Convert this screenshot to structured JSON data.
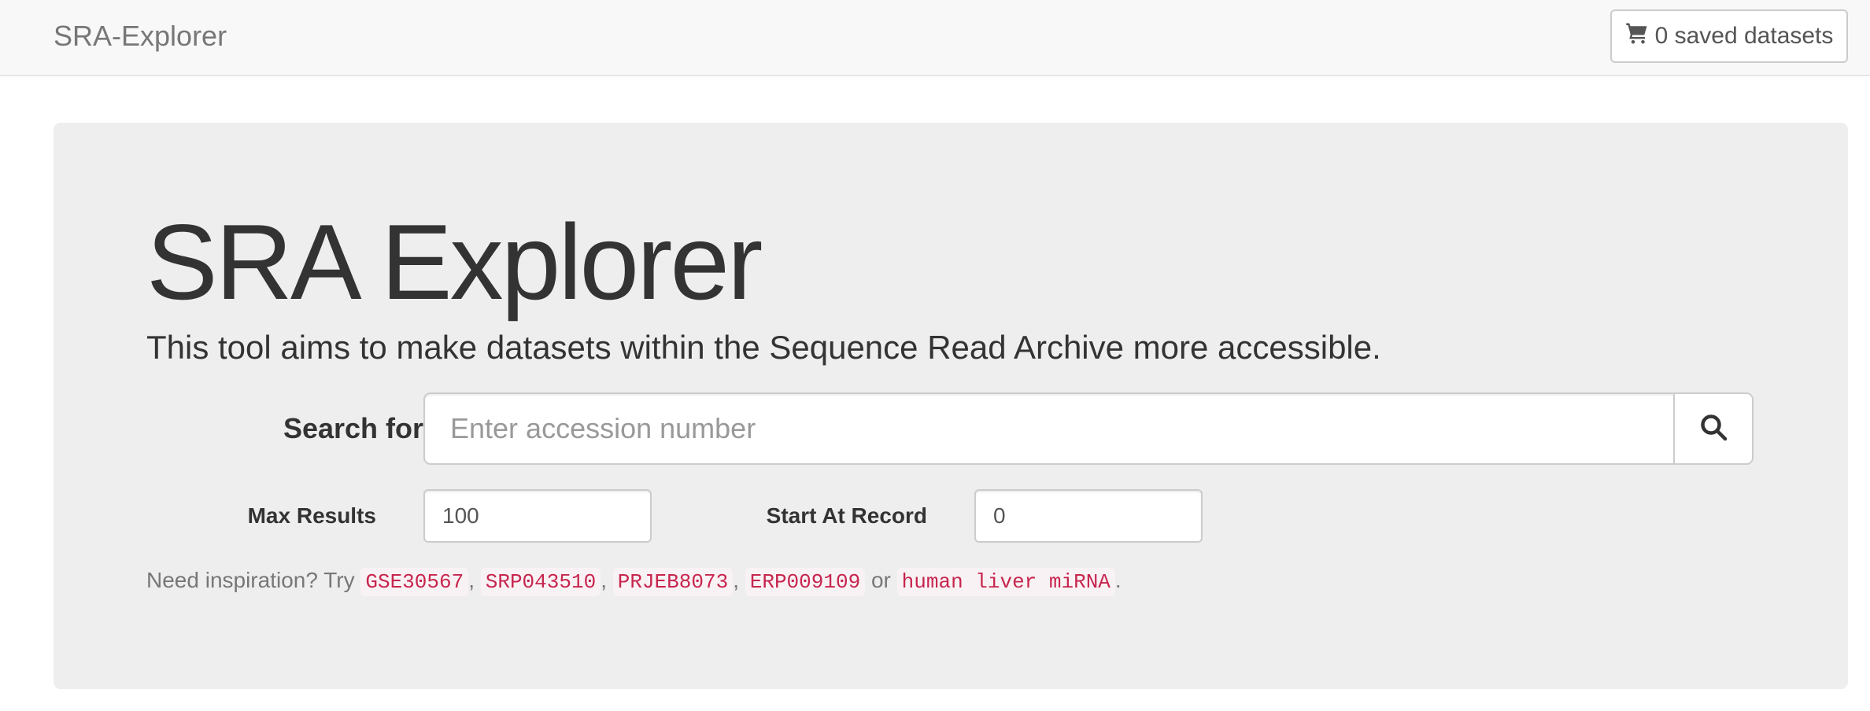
{
  "navbar": {
    "brand": "SRA-Explorer",
    "cart_label": "0 saved datasets",
    "cart_icon": "shopping-cart-icon"
  },
  "jumbotron": {
    "title": "SRA Explorer",
    "lead": "This tool aims to make datasets within the Sequence Read Archive more accessible."
  },
  "search": {
    "label": "Search for:",
    "placeholder": "Enter accession number",
    "value": "",
    "button_icon": "search-icon"
  },
  "options": {
    "max_results_label": "Max Results",
    "max_results_value": "100",
    "start_at_label": "Start At Record",
    "start_at_value": "0"
  },
  "inspiration": {
    "prefix": "Need inspiration? Try",
    "examples": [
      "GSE30567",
      "SRP043510",
      "PRJEB8073",
      "ERP009109",
      "human liver miRNA"
    ],
    "sep_comma": ",",
    "sep_or": "or",
    "suffix": "."
  },
  "colors": {
    "navbar_bg": "#f8f8f8",
    "jumbotron_bg": "#eeeeee",
    "code_text": "#c7254e",
    "code_bg": "#f9f2f4"
  }
}
